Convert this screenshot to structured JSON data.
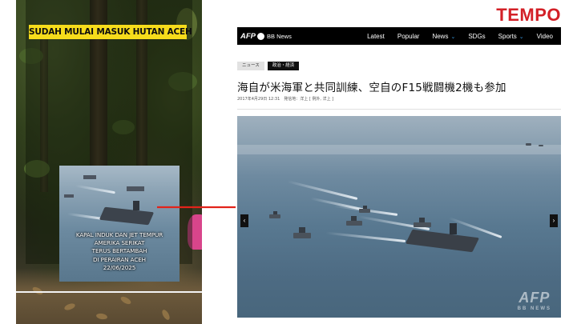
{
  "left": {
    "banner_text": "SUDAH MULAI MASUK HUTAN ACEH",
    "inset_caption_lines": [
      "KAPAL INDUK DAN JET TEMPUR",
      "AMERIKA SERIKAT",
      "TERUS BERTAMBAH",
      "DI PERAIRAN ACEH",
      "22/06/2025"
    ]
  },
  "right": {
    "publisher_logo": "TEMPO",
    "brand_color": "#d32027",
    "afp_logo": "AFP",
    "afp_bbnews": "BB News",
    "nav_items": [
      {
        "label": "Latest",
        "dropdown": false
      },
      {
        "label": "Popular",
        "dropdown": false
      },
      {
        "label": "News",
        "dropdown": true
      },
      {
        "label": "SDGs",
        "dropdown": false
      },
      {
        "label": "Sports",
        "dropdown": true
      },
      {
        "label": "Video",
        "dropdown": false
      }
    ],
    "tags": [
      "ニュース",
      "政治・経済"
    ],
    "headline": "海自が米海軍と共同訓練、空自のF15戦闘機2機も参加",
    "dateline": "2017年4月29日 12:31　発信地：洋上 [ 例外, 洋上 ]",
    "photo_prev": "‹",
    "photo_next": "›",
    "watermark_big": "AFP",
    "watermark_small": "BB NEWS"
  },
  "arrow_color": "#e2231a"
}
